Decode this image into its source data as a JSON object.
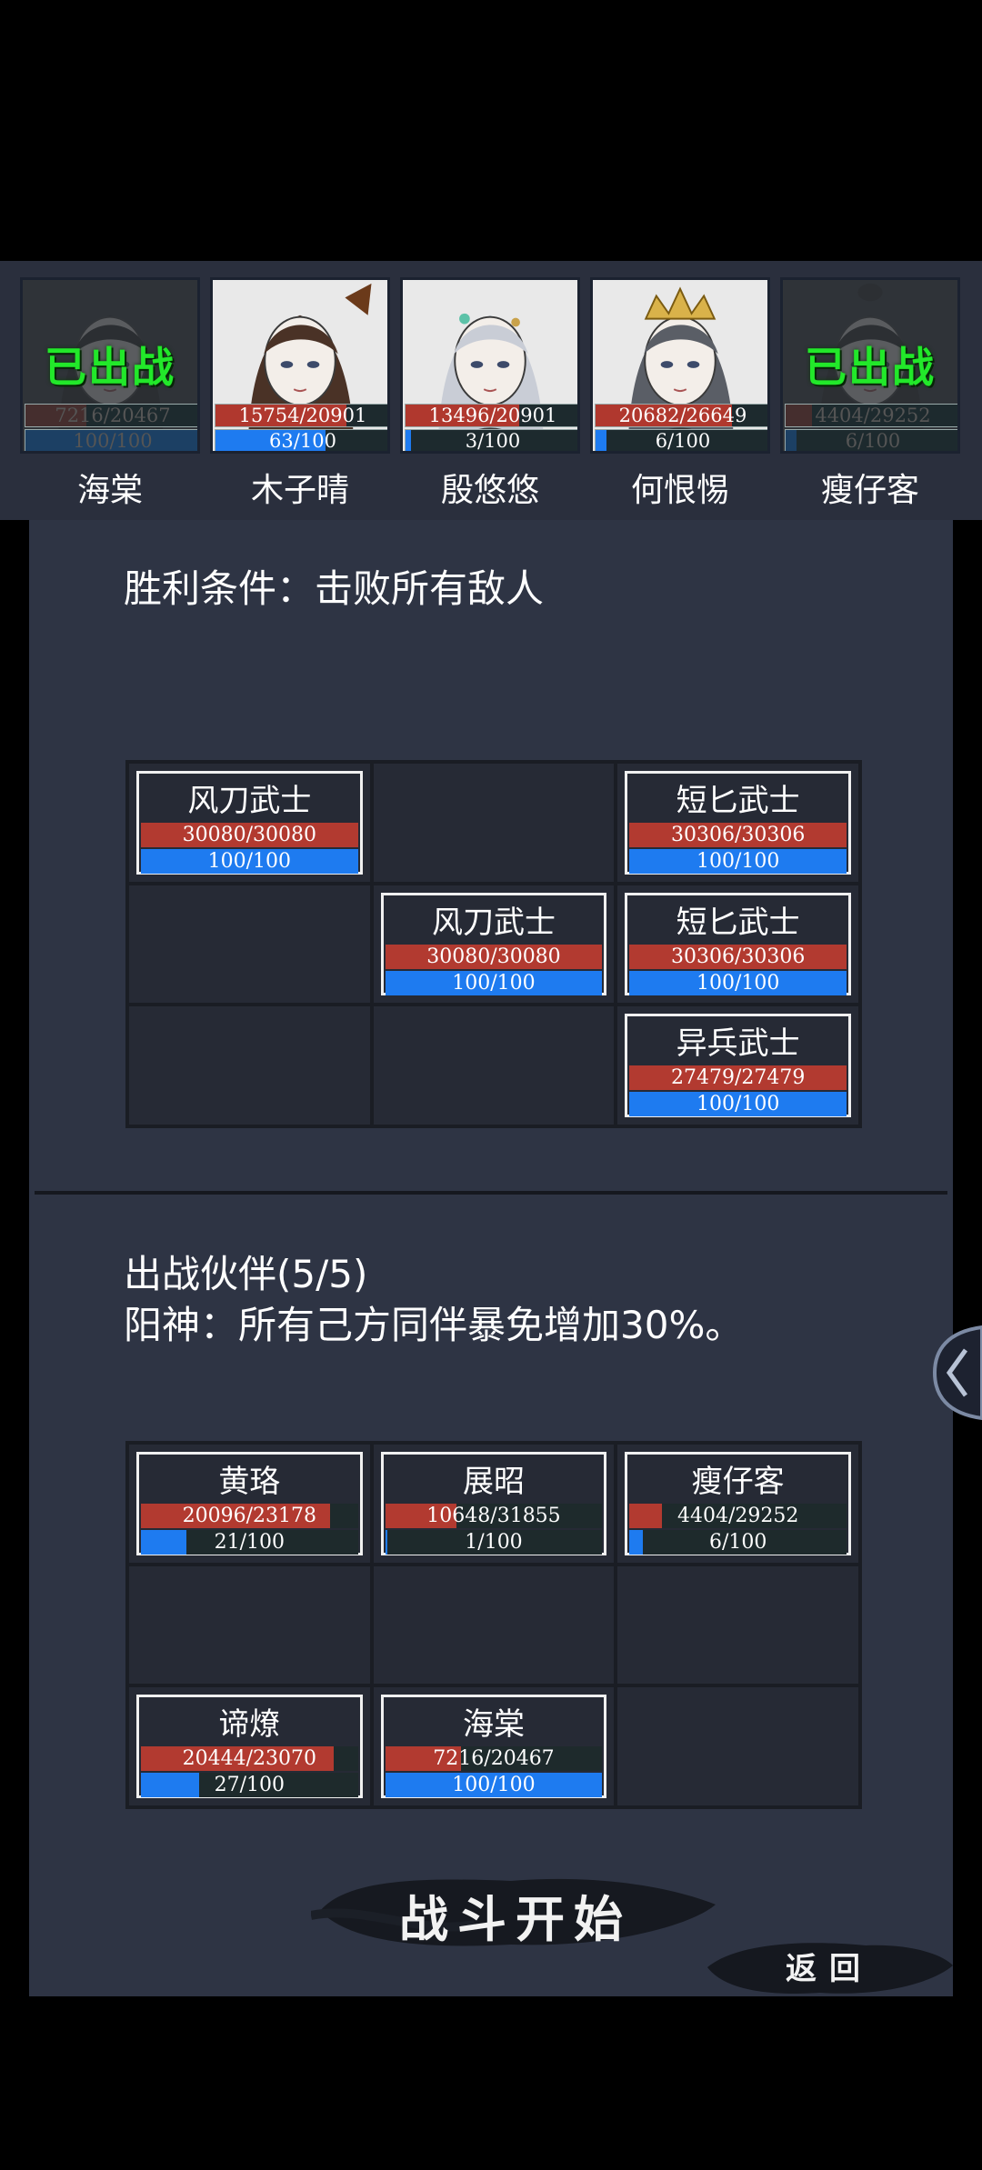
{
  "roster": [
    {
      "name": "海棠",
      "hp": "7216/20467",
      "hp_ratio": 0.35,
      "mp": "100/100",
      "mp_ratio": 1.0,
      "deployed": true,
      "deployed_label": "已出战",
      "portrait": "dark-haired-woman-portrait"
    },
    {
      "name": "木子晴",
      "hp": "15754/20901",
      "hp_ratio": 0.75,
      "mp": "63/100",
      "mp_ratio": 0.63,
      "deployed": false,
      "portrait": "brown-haired-woman-portrait"
    },
    {
      "name": "殷悠悠",
      "hp": "13496/20901",
      "hp_ratio": 0.65,
      "mp": "3/100",
      "mp_ratio": 0.03,
      "deployed": false,
      "portrait": "silver-haired-woman-portrait"
    },
    {
      "name": "何恨惕",
      "hp": "20682/26649",
      "hp_ratio": 0.78,
      "mp": "6/100",
      "mp_ratio": 0.06,
      "deployed": false,
      "portrait": "crowned-woman-portrait"
    },
    {
      "name": "瘦仔客",
      "hp": "4404/29252",
      "hp_ratio": 0.15,
      "mp": "6/100",
      "mp_ratio": 0.06,
      "deployed": true,
      "deployed_label": "已出战",
      "portrait": "topknot-man-portrait"
    }
  ],
  "victory_condition": "胜利条件：击败所有敌人",
  "enemy_grid": [
    [
      {
        "name": "风刀武士",
        "hp": "30080/30080",
        "hp_ratio": 1.0,
        "mp": "100/100",
        "mp_ratio": 1.0
      },
      null,
      {
        "name": "短匕武士",
        "hp": "30306/30306",
        "hp_ratio": 1.0,
        "mp": "100/100",
        "mp_ratio": 1.0
      }
    ],
    [
      null,
      {
        "name": "风刀武士",
        "hp": "30080/30080",
        "hp_ratio": 1.0,
        "mp": "100/100",
        "mp_ratio": 1.0
      },
      {
        "name": "短匕武士",
        "hp": "30306/30306",
        "hp_ratio": 1.0,
        "mp": "100/100",
        "mp_ratio": 1.0
      }
    ],
    [
      null,
      null,
      {
        "name": "异兵武士",
        "hp": "27479/27479",
        "hp_ratio": 1.0,
        "mp": "100/100",
        "mp_ratio": 1.0
      }
    ]
  ],
  "partner_title": "出战伙伴(5/5)",
  "partner_skill": "阳神：所有己方同伴暴免增加30%。",
  "ally_grid": [
    [
      {
        "name": "黄珞",
        "hp": "20096/23178",
        "hp_ratio": 0.87,
        "mp": "21/100",
        "mp_ratio": 0.21
      },
      {
        "name": "展昭",
        "hp": "10648/31855",
        "hp_ratio": 0.33,
        "mp": "1/100",
        "mp_ratio": 0.01
      },
      {
        "name": "瘦仔客",
        "hp": "4404/29252",
        "hp_ratio": 0.15,
        "mp": "6/100",
        "mp_ratio": 0.06
      }
    ],
    [
      null,
      null,
      null
    ],
    [
      {
        "name": "谛燎",
        "hp": "20444/23070",
        "hp_ratio": 0.89,
        "mp": "27/100",
        "mp_ratio": 0.27
      },
      {
        "name": "海棠",
        "hp": "7216/20467",
        "hp_ratio": 0.35,
        "mp": "100/100",
        "mp_ratio": 1.0
      },
      null
    ]
  ],
  "buttons": {
    "start": "战斗开始",
    "back": "返回"
  },
  "colors": {
    "hp": "#b23a30",
    "mp": "#1e7bf0",
    "deployed": "#22e82a",
    "panel": "#2e3444"
  }
}
